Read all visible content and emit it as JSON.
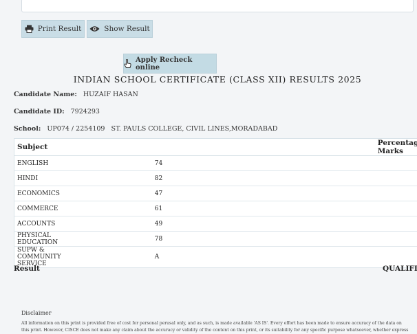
{
  "buttons": {
    "print": "Print Result",
    "show": "Show Result",
    "recheck": "Apply Recheck online"
  },
  "title": "INDIAN SCHOOL CERTIFICATE (CLASS XII) RESULTS 2025",
  "candidate": {
    "name_label": "Candidate Name:",
    "name": "HUZAIF HASAN",
    "id_label": "Candidate ID:",
    "id": "7924293",
    "school_label": "School:",
    "school": "UP074 / 2254109   ST. PAULS COLLEGE, CIVIL LINES,MORADABAD"
  },
  "table": {
    "headers": [
      "Subject",
      "Percentage Marks"
    ],
    "rows": [
      [
        "ENGLISH",
        "74"
      ],
      [
        "HINDI",
        "82"
      ],
      [
        "ECONOMICS",
        "47"
      ],
      [
        "COMMERCE",
        "61"
      ],
      [
        "ACCOUNTS",
        "49"
      ],
      [
        "PHYSICAL EDUCATION",
        "78"
      ],
      [
        "SUPW & COMMUNITY SERVICE",
        "A"
      ]
    ]
  },
  "result": {
    "label": "Result",
    "value": "QUALIFIE"
  },
  "disclaimer": {
    "title": "Disclaimer",
    "line1": "All information on this print is provided free of cost for personal perusal only, and as such, is made available 'AS IS'. Every effort has been made to ensure accuracy of the data on",
    "line2": "this print. However, CISCE does not make any claim about the accuracy or validity of the content on this print, or its suitability for any specific purpose whatsoever, whether express"
  },
  "icons": {
    "print": "printer-icon",
    "show": "eye-icon",
    "recheck": "hand-pointer-icon"
  }
}
